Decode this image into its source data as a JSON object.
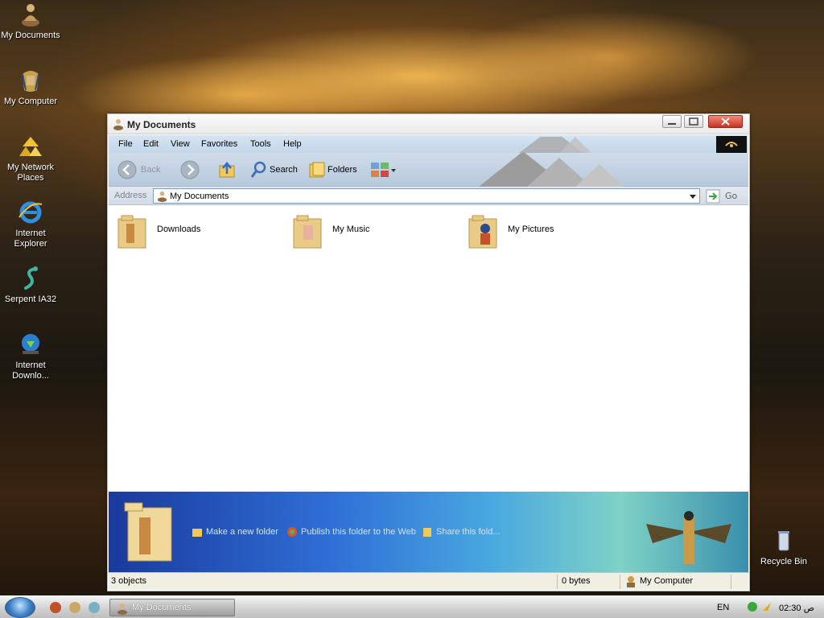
{
  "desktop": {
    "icons": [
      {
        "label": "My Documents"
      },
      {
        "label": "My Computer"
      },
      {
        "label": "My Network Places"
      },
      {
        "label": "Internet Explorer"
      },
      {
        "label": "Serpent IA32"
      },
      {
        "label": "Internet Downlo..."
      },
      {
        "label": "Recycle Bin"
      }
    ]
  },
  "window": {
    "title": "My Documents",
    "menu": [
      "File",
      "Edit",
      "View",
      "Favorites",
      "Tools",
      "Help"
    ],
    "toolbar": {
      "back_label": "Back",
      "search_label": "Search",
      "folders_label": "Folders"
    },
    "address": {
      "label": "Address",
      "value": "My Documents",
      "go_label": "Go"
    },
    "items": [
      {
        "name": "Downloads"
      },
      {
        "name": "My Music"
      },
      {
        "name": "My Pictures"
      }
    ],
    "tasks": [
      {
        "label": "Make a new folder"
      },
      {
        "label": "Publish this folder to the Web"
      },
      {
        "label": "Share this fold..."
      }
    ],
    "status": {
      "objects": "3 objects",
      "size": "0 bytes",
      "zone": "My Computer"
    }
  },
  "taskbar": {
    "active_task": "My Documents",
    "language": "EN",
    "clock": "02:30 ص"
  },
  "colors": {
    "menubar": "#c4d6ea",
    "taskpanel_start": "#1a3a9c",
    "taskpanel_end": "#7fd2c6",
    "close_button": "#c9331e"
  }
}
